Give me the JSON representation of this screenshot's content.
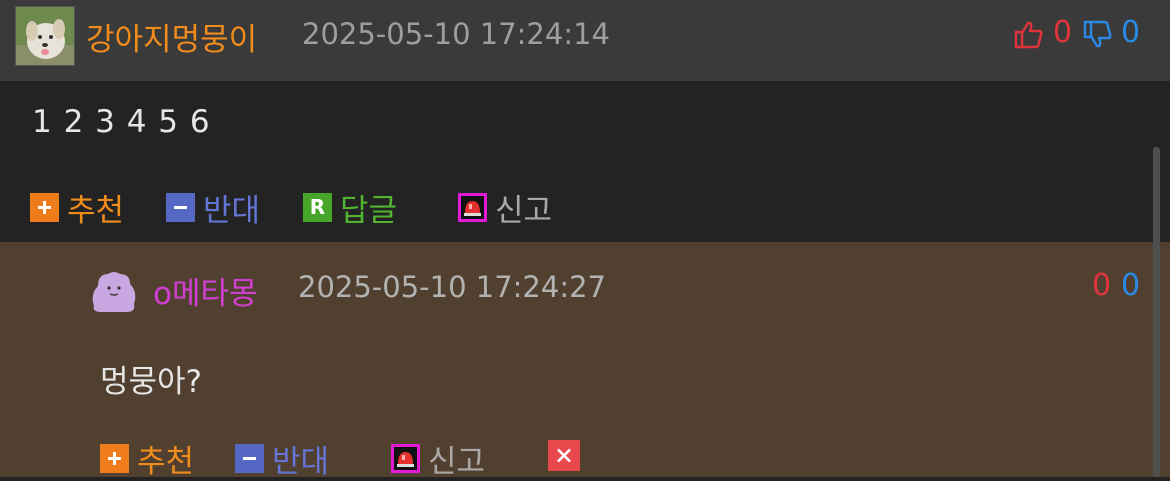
{
  "comment": {
    "nickname": "강아지멍뭉이",
    "datetime": "2025-05-10 17:24:14",
    "likes": "0",
    "dislikes": "0",
    "body": "1 2 3 4 5 6",
    "actions": {
      "recommend": "추천",
      "oppose": "반대",
      "reply": "답글",
      "report": "신고"
    }
  },
  "reply": {
    "nickname": "o메타몽",
    "datetime": "2025-05-10 17:24:27",
    "likes": "0",
    "dislikes": "0",
    "body": "멍뭉아?",
    "actions": {
      "recommend": "추천",
      "oppose": "반대",
      "report": "신고"
    }
  },
  "colors": {
    "nickname_orange": "#f08c1c",
    "nickname_purple": "#d13fd1",
    "like_red": "#e0343c",
    "dislike_blue": "#2a8ae6",
    "reply_green": "#52b432",
    "oppose_blue": "#6575d6"
  },
  "icons": {
    "avatar": "puppy-avatar",
    "reply_avatar": "ditto-avatar",
    "like": "thumbs-up-icon",
    "dislike": "thumbs-down-icon",
    "plus": "plus-icon",
    "minus": "minus-icon",
    "reply": "reply-r-icon",
    "report": "siren-icon",
    "delete": "close-icon"
  }
}
